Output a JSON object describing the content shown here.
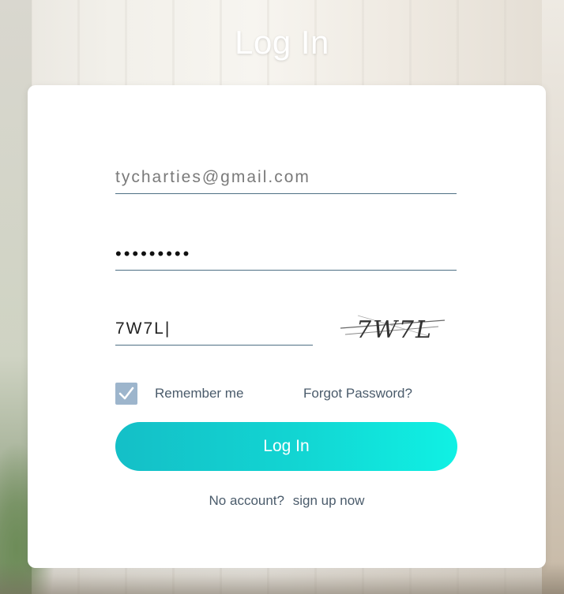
{
  "header": {
    "title": "Log In"
  },
  "form": {
    "email_value": "tycharties@gmail.com",
    "password_value": "•••••••••",
    "captcha_value": "7W7L|",
    "captcha_image_text": "7W7L",
    "remember_checked": true,
    "remember_label": "Remember me",
    "forgot_label": "Forgot Password?",
    "login_button_label": "Log In",
    "no_account_text": "No account?",
    "signup_link_text": "sign up now"
  },
  "colors": {
    "accent_start": "#14bfc7",
    "accent_end": "#10f1e4",
    "checkbox_fill": "#9db5cc",
    "text_muted": "#4a5b6b",
    "underline": "#4e6f84"
  },
  "icons": {
    "checkbox": "checkmark-icon"
  }
}
